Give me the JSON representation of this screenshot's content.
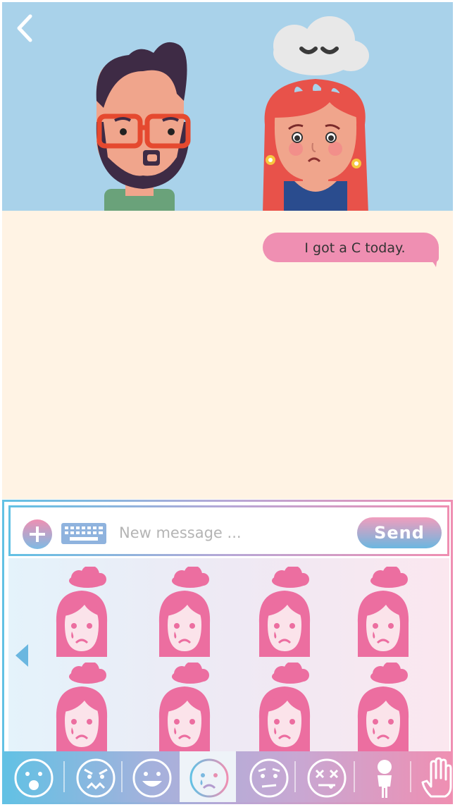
{
  "chat": {
    "messages": [
      {
        "text": "I got a C today.",
        "from": "me"
      }
    ]
  },
  "composer": {
    "placeholder": "New message ...",
    "send_label": "Send"
  },
  "sticker_grid": {
    "selected_category": "sad",
    "sticker_count": 8
  },
  "categories": [
    {
      "name": "surprised-icon"
    },
    {
      "name": "angry-icon"
    },
    {
      "name": "happy-icon"
    },
    {
      "name": "sad-icon",
      "active": true
    },
    {
      "name": "worried-icon"
    },
    {
      "name": "dizzy-icon"
    },
    {
      "name": "person-icon"
    },
    {
      "name": "hand-icon"
    }
  ],
  "colors": {
    "pink": "#ef8fb2",
    "blue": "#62c1e4",
    "sky": "#a9d2ea",
    "chat_bg": "#fff3e4"
  }
}
